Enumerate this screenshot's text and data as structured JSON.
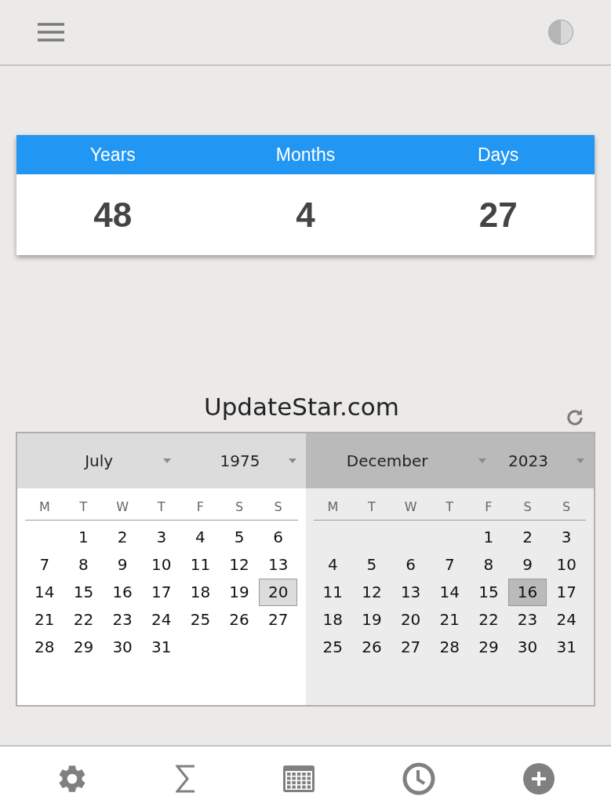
{
  "result": [
    {
      "label": "Years",
      "value": "48"
    },
    {
      "label": "Months",
      "value": "4"
    },
    {
      "label": "Days",
      "value": "27"
    }
  ],
  "title": "UpdateStar.com",
  "calendars": [
    {
      "active": false,
      "month": "July",
      "year": "1975",
      "weekdays": [
        "M",
        "T",
        "W",
        "T",
        "F",
        "S",
        "S"
      ],
      "weeks": [
        [
          {
            "day": "1",
            "selected": false
          },
          {
            "day": "2",
            "selected": false
          },
          {
            "day": "3",
            "selected": false
          },
          {
            "day": "4",
            "selected": false
          },
          {
            "day": "5",
            "selected": false
          },
          {
            "day": "6",
            "selected": false
          }
        ],
        [
          {
            "day": "7",
            "selected": false
          },
          {
            "day": "8",
            "selected": false
          },
          {
            "day": "9",
            "selected": false
          },
          {
            "day": "10",
            "selected": false
          },
          {
            "day": "11",
            "selected": false
          },
          {
            "day": "12",
            "selected": false
          },
          {
            "day": "13",
            "selected": false
          }
        ],
        [
          {
            "day": "14",
            "selected": false
          },
          {
            "day": "15",
            "selected": false
          },
          {
            "day": "16",
            "selected": false
          },
          {
            "day": "17",
            "selected": false
          },
          {
            "day": "18",
            "selected": false
          },
          {
            "day": "19",
            "selected": false
          },
          {
            "day": "20",
            "selected": true
          }
        ],
        [
          {
            "day": "21",
            "selected": false
          },
          {
            "day": "22",
            "selected": false
          },
          {
            "day": "23",
            "selected": false
          },
          {
            "day": "24",
            "selected": false
          },
          {
            "day": "25",
            "selected": false
          },
          {
            "day": "26",
            "selected": false
          },
          {
            "day": "27",
            "selected": false
          }
        ],
        [
          {
            "day": "28",
            "selected": false
          },
          {
            "day": "29",
            "selected": false
          },
          {
            "day": "30",
            "selected": false
          },
          {
            "day": "31",
            "selected": false
          }
        ]
      ]
    },
    {
      "active": true,
      "month": "December",
      "year": "2023",
      "weekdays": [
        "M",
        "T",
        "W",
        "T",
        "F",
        "S",
        "S"
      ],
      "weeks": [
        [
          {
            "day": "1",
            "selected": false
          },
          {
            "day": "2",
            "selected": false
          },
          {
            "day": "3",
            "selected": false
          }
        ],
        [
          {
            "day": "4",
            "selected": false
          },
          {
            "day": "5",
            "selected": false
          },
          {
            "day": "6",
            "selected": false
          },
          {
            "day": "7",
            "selected": false
          },
          {
            "day": "8",
            "selected": false
          },
          {
            "day": "9",
            "selected": false
          },
          {
            "day": "10",
            "selected": false
          }
        ],
        [
          {
            "day": "11",
            "selected": false
          },
          {
            "day": "12",
            "selected": false
          },
          {
            "day": "13",
            "selected": false
          },
          {
            "day": "14",
            "selected": false
          },
          {
            "day": "15",
            "selected": false
          },
          {
            "day": "16",
            "selected": true
          },
          {
            "day": "17",
            "selected": false
          }
        ],
        [
          {
            "day": "18",
            "selected": false
          },
          {
            "day": "19",
            "selected": false
          },
          {
            "day": "20",
            "selected": false
          },
          {
            "day": "21",
            "selected": false
          },
          {
            "day": "22",
            "selected": false
          },
          {
            "day": "23",
            "selected": false
          },
          {
            "day": "24",
            "selected": false
          }
        ],
        [
          {
            "day": "25",
            "selected": false
          },
          {
            "day": "26",
            "selected": false
          },
          {
            "day": "27",
            "selected": false
          },
          {
            "day": "28",
            "selected": false
          },
          {
            "day": "29",
            "selected": false
          },
          {
            "day": "30",
            "selected": false
          },
          {
            "day": "31",
            "selected": false
          }
        ]
      ]
    }
  ],
  "nav": [
    {
      "kind": "settings"
    },
    {
      "kind": "sum"
    },
    {
      "kind": "calendar"
    },
    {
      "kind": "clock"
    },
    {
      "kind": "add"
    }
  ]
}
